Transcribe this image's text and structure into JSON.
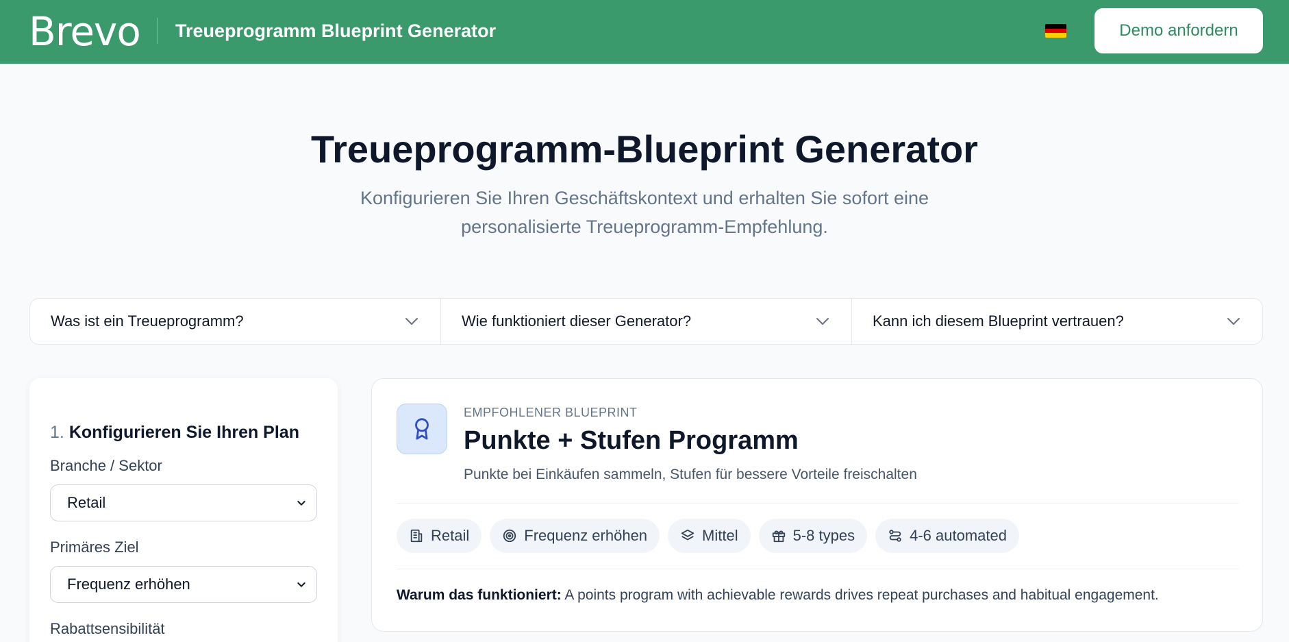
{
  "header": {
    "logo_text": "Brevo",
    "app_title": "Treueprogramm Blueprint Generator",
    "language_flag": "flag-de-icon",
    "demo_button": "Demo anfordern",
    "brand_color": "#3a9a6c"
  },
  "hero": {
    "title": "Treueprogramm-Blueprint Generator",
    "subtitle": "Konfigurieren Sie Ihren Geschäftskontext und erhalten Sie sofort eine personalisierte Treueprogramm-Empfehlung."
  },
  "faq": [
    {
      "label": "Was ist ein Treueprogramm?"
    },
    {
      "label": "Wie funktioniert dieser Generator?"
    },
    {
      "label": "Kann ich diesem Blueprint vertrauen?"
    }
  ],
  "config": {
    "step": "1.",
    "heading": "Konfigurieren Sie Ihren Plan",
    "fields": [
      {
        "label": "Branche / Sektor",
        "value": "Retail"
      },
      {
        "label": "Primäres Ziel",
        "value": "Frequenz erhöhen"
      },
      {
        "label": "Rabattsensibilität"
      }
    ]
  },
  "blueprint": {
    "eyebrow": "EMPFOHLENER BLUEPRINT",
    "title": "Punkte + Stufen Programm",
    "description": "Punkte bei Einkäufen sammeln, Stufen für bessere Vorteile freischalten",
    "icon": "award-ribbon-icon",
    "icon_color": "#2f4fc4",
    "tags": [
      {
        "icon": "building-icon",
        "label": "Retail"
      },
      {
        "icon": "target-icon",
        "label": "Frequenz erhöhen"
      },
      {
        "icon": "layers-icon",
        "label": "Mittel"
      },
      {
        "icon": "gift-icon",
        "label": "5-8 types"
      },
      {
        "icon": "workflow-icon",
        "label": "4-6 automated"
      }
    ],
    "why_label": "Warum das funktioniert:",
    "why_text": "A points program with achievable rewards drives repeat purchases and habitual engagement."
  }
}
